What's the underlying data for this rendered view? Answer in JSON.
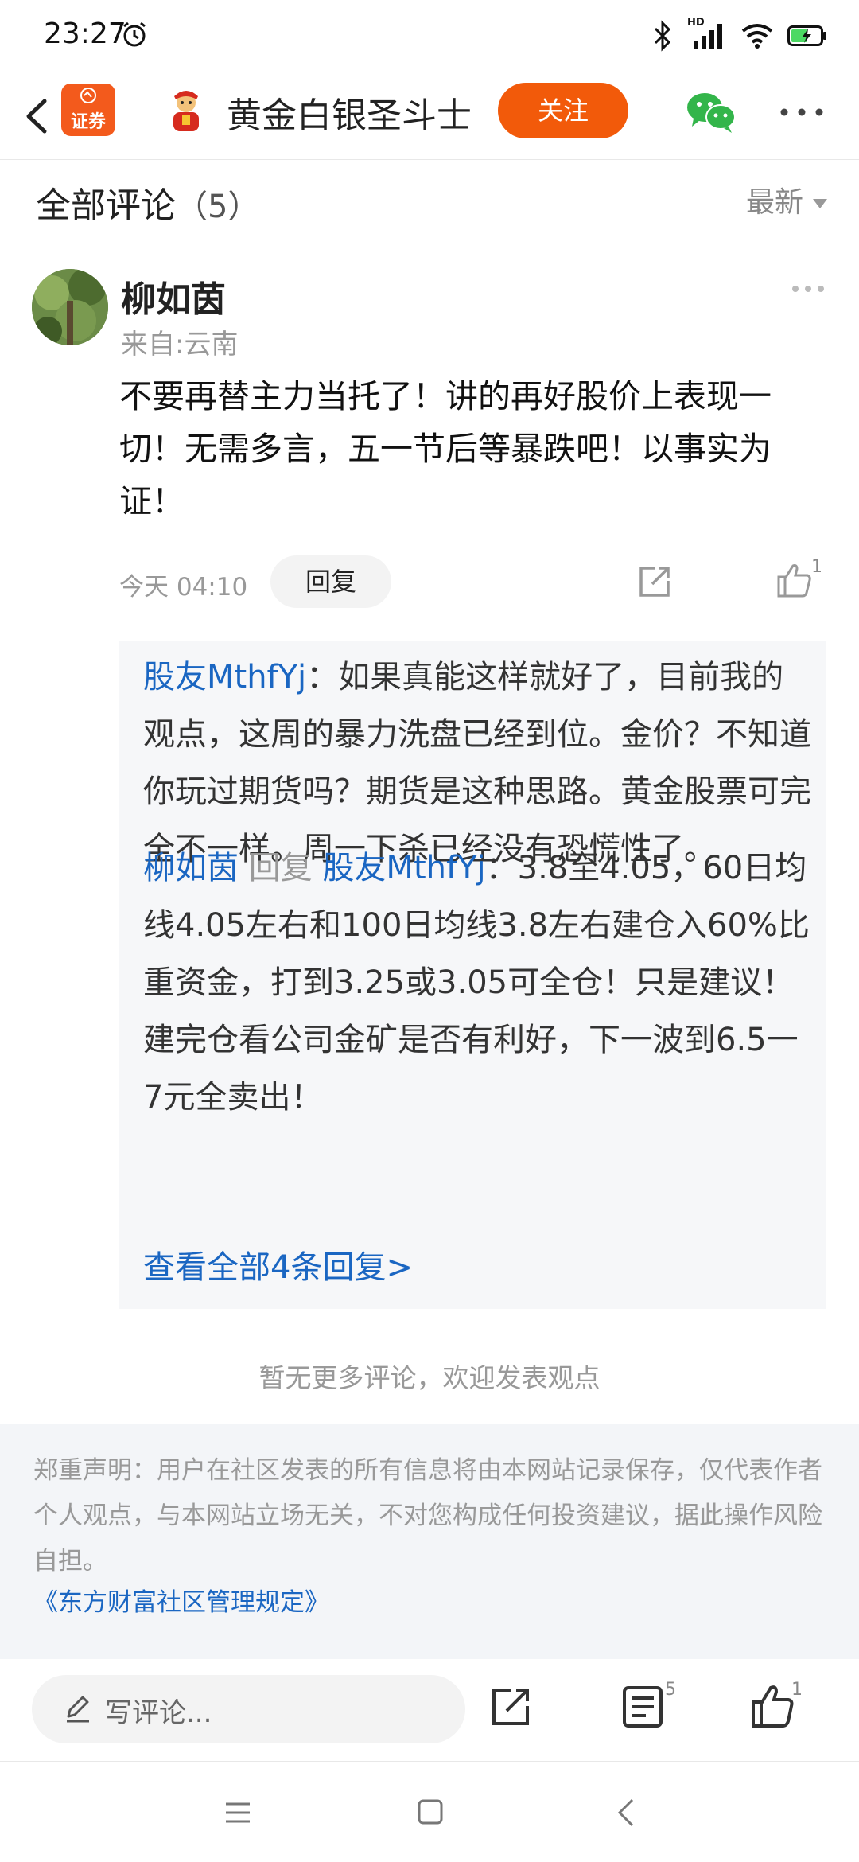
{
  "status_bar": {
    "time": "23:27",
    "network_badge": "HD"
  },
  "header": {
    "app_logo_label": "证券",
    "stock_name": "黄金白银圣斗士",
    "follow_label": "关注"
  },
  "comments": {
    "title": "全部评论",
    "count": "（5）",
    "sort_label": "最新"
  },
  "comment": {
    "username": "柳如茵",
    "location": "来自:云南",
    "text": "不要再替主力当托了！讲的再好股价上表现一切！无需多言，五一节后等暴跌吧！以事实为证！",
    "time": "今天 04:10",
    "reply_label": "回复",
    "like_count": "1"
  },
  "replies": [
    {
      "author": "股友MthfYj",
      "text": "：如果真能这样就好了，目前我的观点，这周的暴力洗盘已经到位。金价？不知道你玩过期货吗？期货是这种思路。黄金股票可完全不一样。周一下杀已经没有恐慌性了。"
    },
    {
      "author": "柳如茵",
      "reply_word": "回复",
      "target": "股友MthfYj",
      "text": "：3.8至4.05，60日均线4.05左右和100日均线3.8左右建仓入60%比重资金，打到3.25或3.05可全仓！只是建议！建完仓看公司金矿是否有利好，下一波到6.5一7元全卖出！"
    }
  ],
  "view_all_replies": "查看全部4条回复>",
  "no_more": "暂无更多评论，欢迎发表观点",
  "disclaimer": {
    "text": "郑重声明：用户在社区发表的所有信息将由本网站记录保存，仅代表作者个人观点，与本网站立场无关，不对您构成任何投资建议，据此操作风险自担。",
    "link": "《东方财富社区管理规定》"
  },
  "toolbar": {
    "write_placeholder": "写评论...",
    "comment_count": "5",
    "like_count": "1"
  },
  "colors": {
    "accent_orange": "#f25a0a",
    "link_blue": "#1a66c2",
    "wechat_green": "#33b54a"
  }
}
